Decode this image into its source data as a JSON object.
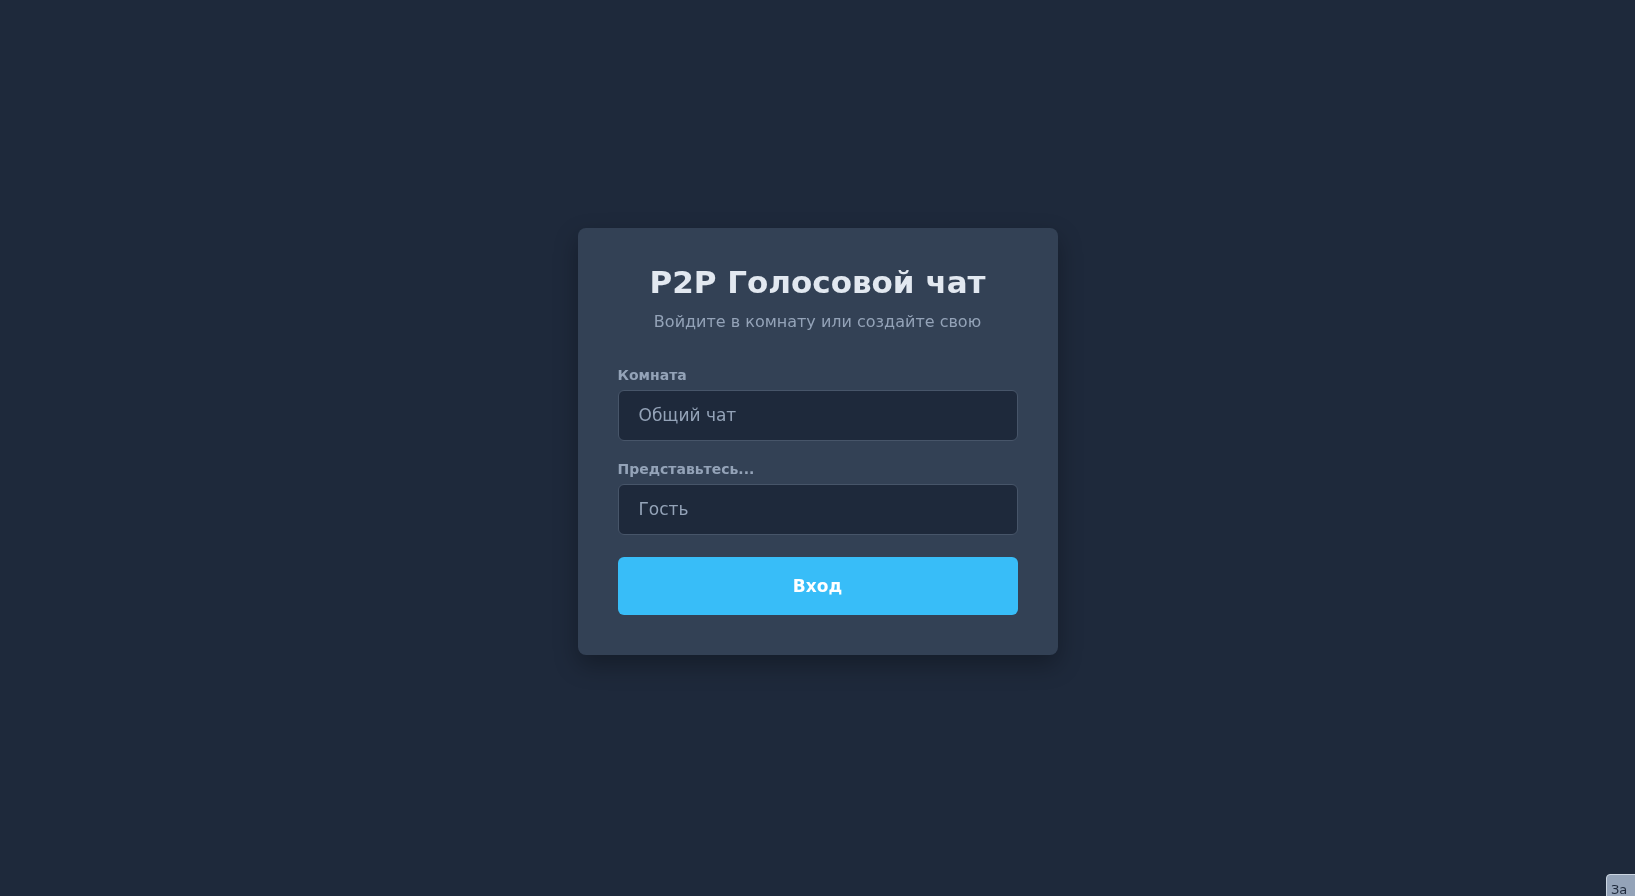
{
  "login_card": {
    "title": "P2P Голосовой чат",
    "subtitle": "Войдите в комнату или создайте свою",
    "fields": [
      {
        "label": "Комната",
        "placeholder": "Общий чат"
      },
      {
        "label": "Представьтесь...",
        "placeholder": "Гость"
      }
    ],
    "submit_button": "Вход"
  },
  "corner_button": "За"
}
